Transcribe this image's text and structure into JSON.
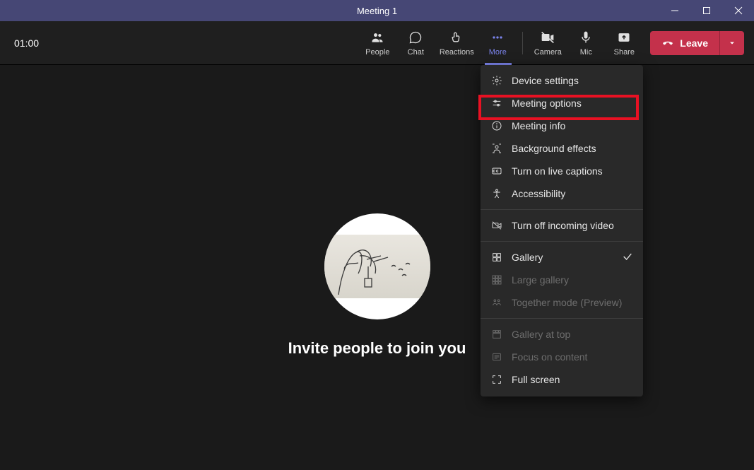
{
  "window": {
    "title": "Meeting 1"
  },
  "toolbar": {
    "timer": "01:00",
    "people": "People",
    "chat": "Chat",
    "reactions": "Reactions",
    "more": "More",
    "camera": "Camera",
    "mic": "Mic",
    "share": "Share",
    "leave": "Leave"
  },
  "stage": {
    "invite": "Invite people to join you"
  },
  "menu": {
    "device_settings": "Device settings",
    "meeting_options": "Meeting options",
    "meeting_info": "Meeting info",
    "background_effects": "Background effects",
    "live_captions": "Turn on live captions",
    "accessibility": "Accessibility",
    "turn_off_incoming": "Turn off incoming video",
    "gallery": "Gallery",
    "large_gallery": "Large gallery",
    "together_mode": "Together mode (Preview)",
    "gallery_at_top": "Gallery at top",
    "focus_content": "Focus on content",
    "full_screen": "Full screen"
  }
}
